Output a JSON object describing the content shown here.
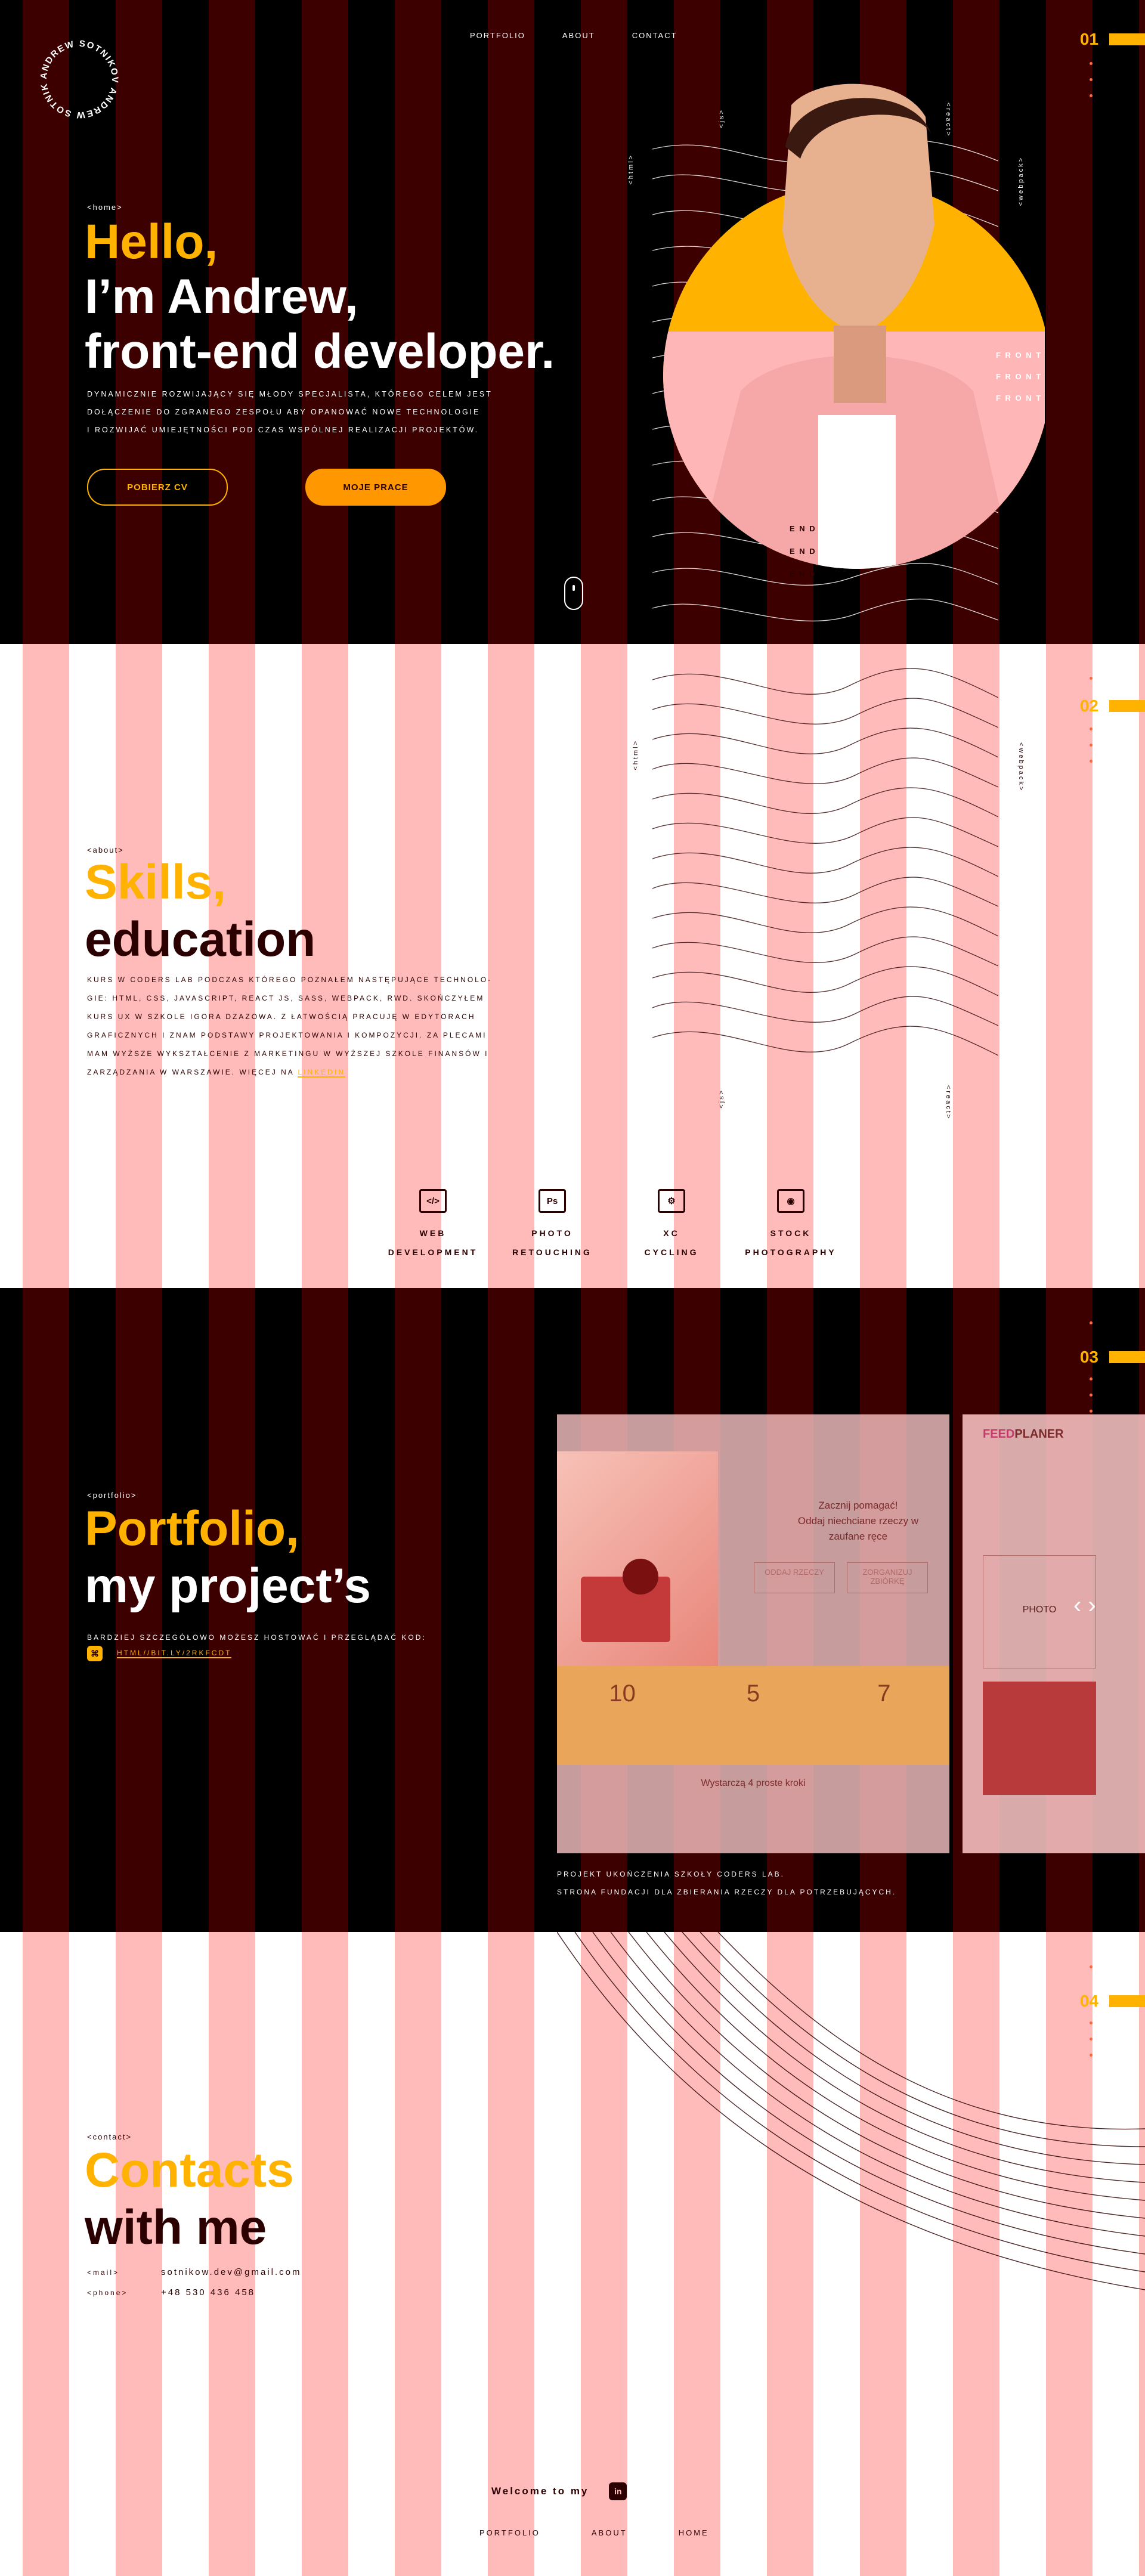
{
  "colors": {
    "accent": "#ffb300",
    "dark": "#3d0000",
    "pink": "#ffbaba"
  },
  "logo": {
    "text": "ANDREW SOTNIKOV ANDREW SOTNIKOV "
  },
  "nav": {
    "portfolio": "PORTFOLIO",
    "about": "ABOUT",
    "contact": "CONTACT"
  },
  "hero": {
    "counter": "01",
    "tag": "<home>",
    "line1": "Hello,",
    "line2": "I’m Andrew,",
    "line3": "front-end developer.",
    "p1": "DYNAMICZNIE ROZWIJAJĄCY SIĘ MŁODY SPECJALISTA, KTÓREGO CELEM JEST",
    "p2": "DOŁĄCZENIE DO ZGRANEGO ZESPOŁU ABY OPANOWAĆ NOWE TECHNOLOGIE",
    "p3": "I ROZWIJAĆ UMIEJĘTNOŚCI POD CZAS WSPÓLNEJ REALIZACJI PROJEKTÓW.",
    "btn_cv": "POBIERZ CV",
    "btn_works": "MOJE PRACE",
    "labels": {
      "html": "<html>",
      "js": "<js>",
      "react": "<react>",
      "css": "<css>",
      "webpack": "<webpack>"
    },
    "front": [
      "F R O N T",
      "F R O N T",
      "F R O N T"
    ],
    "end": [
      "E N D",
      "E N D",
      "E N D"
    ]
  },
  "about": {
    "counter": "02",
    "tag": "<about>",
    "line1": "Skills,",
    "line2": "education",
    "p": [
      "KURS W CODERS LAB PODCZAS KTÓREGO POZNAŁEM NASTĘPUJĄCE TECHNOLO-",
      "GIE: HTML, CSS, JAVASCRIPT, REACT JS, SASS, WEBPACK, RWD. SKOŃCZYŁEM",
      "KURS UX W SZKOLE IGORA DZAZOWA. Z ŁATWOŚCIĄ PRACUJĘ W EDYTORACH",
      "GRAFICZNYCH I ZNAM PODSTAWY PROJEKTOWANIA I KOMPOZYCJI. ZA PLECAMI",
      "MAM WYŻSZE WYKSZTAŁCENIE Z MARKETINGU W WYŻSZEJ SZKOLE FINANSÓW I"
    ],
    "p_last": "ZARZĄDZANIA W WARSZAWIE. WIĘCEJ NA ",
    "link": "LINKEDIN",
    "labels": {
      "html": "<html>",
      "webpack": "<webpack>",
      "js": "<js>",
      "react": "<react>"
    },
    "skills": [
      {
        "icon": "</>",
        "label": "WEB\nDEVELOPMENT"
      },
      {
        "icon": "Ps",
        "label": "PHOTO\nRETOUCHING"
      },
      {
        "icon": "⚙",
        "label": "XC\nCYCLING"
      },
      {
        "icon": "◉",
        "label": "STOCK\nPHOTOGRAPHY"
      }
    ]
  },
  "portfolio": {
    "counter": "03",
    "tag": "<portfolio>",
    "line1": "Portfolio,",
    "line2": "my project’s",
    "p": "BARDZIEJ SZCZEGÓŁOWO MOŻESZ HOSTOWAĆ I PRZEGLĄDAĆ KOD:",
    "link": "HTML//BIT.LY/2RKFCDT",
    "card1": {
      "cta1": "Zacznij pomagać!",
      "cta2": "Oddaj niechciane rzeczy w zaufane ręce",
      "b1": "ODDAJ RZECZY",
      "b2": "ZORGANIZUJ ZBIÓRKĘ",
      "stats": [
        "10",
        "5",
        "7"
      ],
      "foot": "Wystarczą 4 proste kroki"
    },
    "card2": {
      "brand1": "FEED",
      "brand2": "PLANER",
      "photo": "PHOTO"
    },
    "desc1": "PROJEKT UKOŃCZENIA SZKOŁY CODERS LAB.",
    "desc2": "STRONA FUNDACJI DLA ZBIERANIA RZECZY DLA POTRZEBUJĄCYCH."
  },
  "contact": {
    "counter": "04",
    "tag": "<contact>",
    "line1": "Contacts",
    "line2": "with me",
    "mail_k": "<mail>",
    "mail_v": "sotnikow.dev@gmail.com",
    "phone_k": "<phone>",
    "phone_v": "+48 530 436 458",
    "welcome": "Welcome to my",
    "linkedin_icon": "in",
    "footer": {
      "portfolio": "PORTFOLIO",
      "about": "ABOUT",
      "home": "HOME"
    }
  }
}
